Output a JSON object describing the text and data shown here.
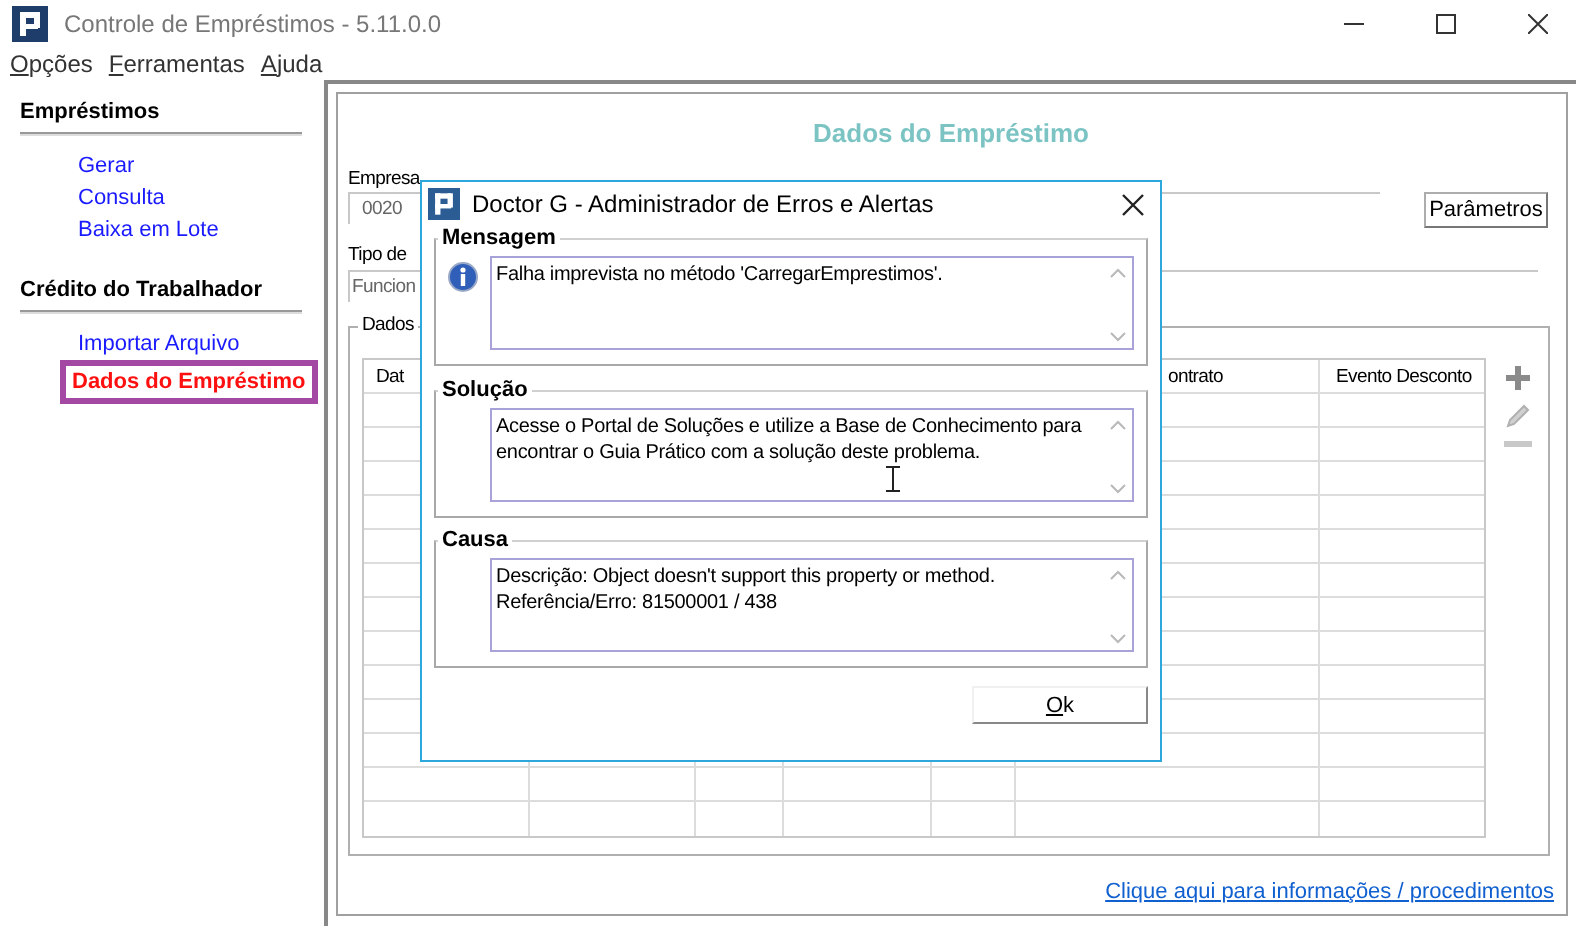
{
  "window": {
    "title": "Controle de Empréstimos - 5.11.0.0"
  },
  "menu": [
    {
      "key": "O",
      "rest": "pções"
    },
    {
      "key": "F",
      "rest": "erramentas"
    },
    {
      "key": "A",
      "rest": "juda"
    }
  ],
  "sidebar": {
    "sections": [
      {
        "title": "Empréstimos",
        "items": [
          {
            "label": "Gerar",
            "selected": false
          },
          {
            "label": "Consulta",
            "selected": false
          },
          {
            "label": "Baixa em Lote",
            "selected": false
          }
        ]
      },
      {
        "title": "Crédito do Trabalhador",
        "items": [
          {
            "label": "Importar Arquivo",
            "selected": false
          },
          {
            "label": "Dados do Empréstimo",
            "selected": true
          }
        ]
      }
    ]
  },
  "page": {
    "title": "Dados do Empréstimo",
    "empresa": {
      "label": "Empresa",
      "value": "0020"
    },
    "parametros_button": "Parâmetros",
    "tipo": {
      "label": "Tipo de",
      "value": "Funcion"
    },
    "group_title": "Dados",
    "table": {
      "columns": [
        "Dat",
        "ontrato",
        "Evento Desconto"
      ]
    },
    "link": "Clique aqui para informações / procedimentos"
  },
  "dialog": {
    "title": "Doctor G - Administrador de Erros e Alertas",
    "sections": [
      {
        "title": "Mensagem",
        "kind": "info",
        "lines": [
          "Falha imprevista no método 'CarregarEmprestimos'."
        ]
      },
      {
        "title": "Solução",
        "kind": "plain",
        "lines": [
          "Acesse o Portal de Soluções e utilize a Base de Conhecimento para encontrar o Guia Prático com a solução deste problema."
        ]
      },
      {
        "title": "Causa",
        "kind": "plain",
        "lines": [
          "Descrição: Object doesn't support this property or method.",
          "Referência/Erro: 81500001 / 438"
        ]
      }
    ],
    "ok": {
      "key": "O",
      "rest": "k"
    }
  }
}
